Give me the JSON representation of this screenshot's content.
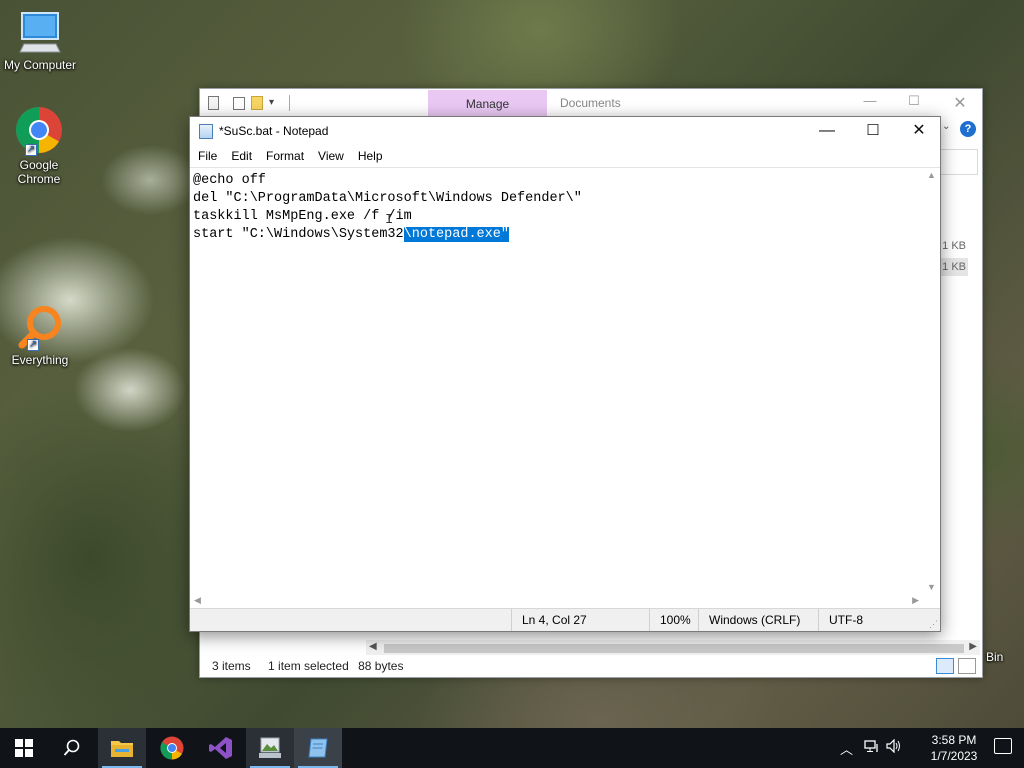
{
  "desktop": {
    "icons": [
      {
        "label": "My Computer"
      },
      {
        "label": "Google Chrome"
      },
      {
        "label": "Everything"
      },
      {
        "label": "Bin"
      }
    ]
  },
  "explorer": {
    "manage_tab": "Manage",
    "title": "Documents",
    "sizes": [
      "1 KB",
      "1 KB"
    ],
    "status": {
      "items": "3 items",
      "selected": "1 item selected",
      "size": "88 bytes"
    }
  },
  "notepad": {
    "title": "*SuSc.bat - Notepad",
    "menu": [
      "File",
      "Edit",
      "Format",
      "View",
      "Help"
    ],
    "lines": [
      "@echo off",
      "del \"C:\\ProgramData\\Microsoft\\Windows Defender\\\"",
      "taskkill MsMpEng.exe /f /im"
    ],
    "line4_prefix": "start \"C:\\Windows\\System32",
    "line4_selected": "\\notepad.exe\"",
    "status": {
      "position": "Ln 4, Col 27",
      "zoom": "100%",
      "line_ending": "Windows (CRLF)",
      "encoding": "UTF-8"
    }
  },
  "taskbar": {
    "clock_time": "3:58 PM",
    "clock_date": "1/7/2023",
    "accent": "#7ab8f0"
  }
}
